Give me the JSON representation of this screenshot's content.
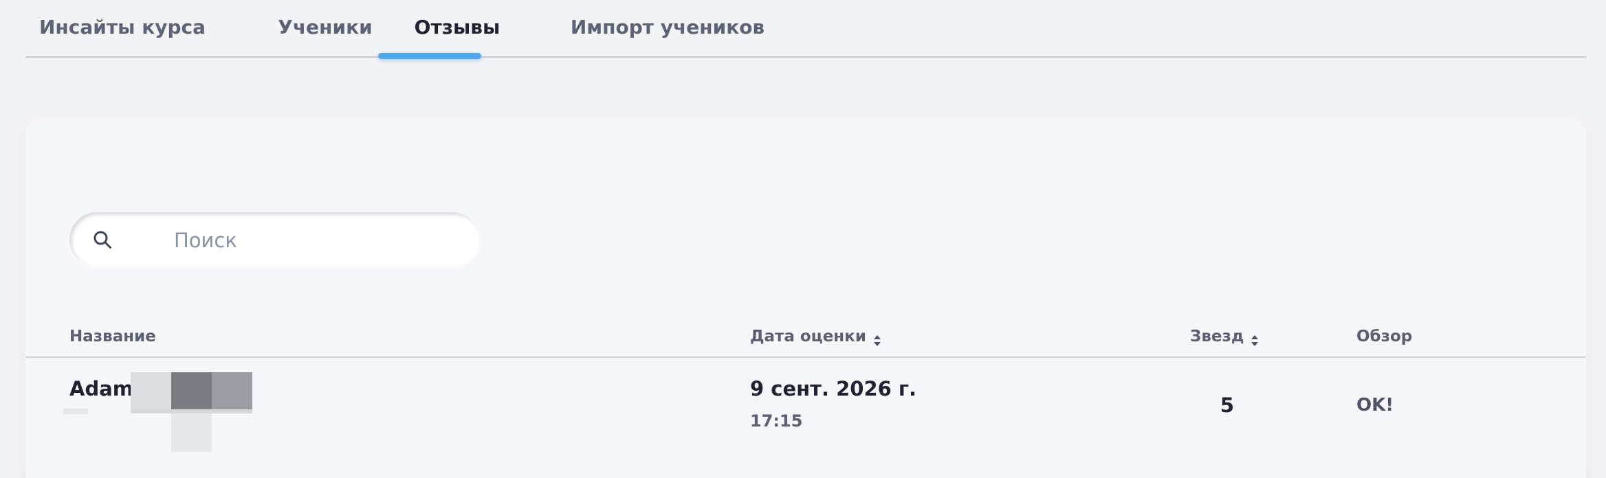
{
  "tabs": [
    {
      "label": "Инсайты курса",
      "active": false
    },
    {
      "label": "Ученики",
      "active": false
    },
    {
      "label": "Отзывы",
      "active": true
    },
    {
      "label": "Импорт учеников",
      "active": false
    }
  ],
  "accent_color": "#4fa9ec",
  "search": {
    "placeholder": "Поиск",
    "value": "",
    "icon": "search-icon"
  },
  "table": {
    "columns": {
      "name": "Название",
      "date": "Дата оценки",
      "stars": "Звезд",
      "review": "Обзор"
    },
    "sortable_icon": "sort-updown-icon",
    "rows": [
      {
        "name": "Adam",
        "date": "9 сент. 2026 г.",
        "time": "17:15",
        "stars": "5",
        "review": "OK!"
      }
    ]
  }
}
